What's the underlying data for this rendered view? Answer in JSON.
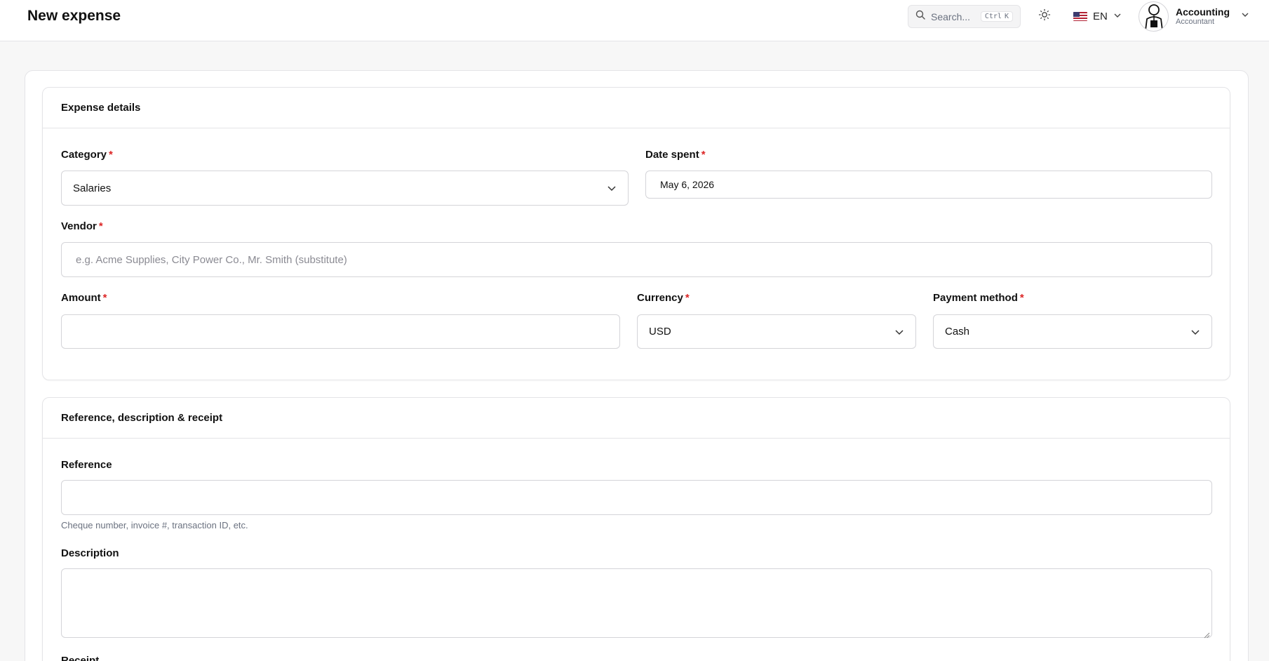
{
  "header": {
    "title": "New expense",
    "search": {
      "placeholder": "Search...",
      "shortcut_mod": "Ctrl",
      "shortcut_key": "K",
      "icon": "search-icon"
    },
    "theme_icon": "sun-icon",
    "language": {
      "flag": "us-flag",
      "code": "EN"
    },
    "user": {
      "name": "Accounting",
      "role": "Accountant"
    }
  },
  "expense_details": {
    "title": "Expense details",
    "category": {
      "label": "Category",
      "value": "Salaries"
    },
    "date_spent": {
      "label": "Date spent",
      "value": "May 6, 2026"
    },
    "vendor": {
      "label": "Vendor",
      "placeholder": "e.g. Acme Supplies, City Power Co., Mr. Smith (substitute)"
    },
    "amount": {
      "label": "Amount",
      "value": ""
    },
    "currency": {
      "label": "Currency",
      "value": "USD"
    },
    "payment_method": {
      "label": "Payment method",
      "value": "Cash"
    },
    "required_mark": "*"
  },
  "reference_section": {
    "title": "Reference, description & receipt",
    "reference": {
      "label": "Reference",
      "value": "",
      "help": "Cheque number, invoice #, transaction ID, etc."
    },
    "description": {
      "label": "Description",
      "value": ""
    },
    "receipt": {
      "label": "Receipt"
    }
  },
  "colors": {
    "required": "#dc2626",
    "border": "#e4e4e7",
    "background": "#f7f7f7"
  }
}
